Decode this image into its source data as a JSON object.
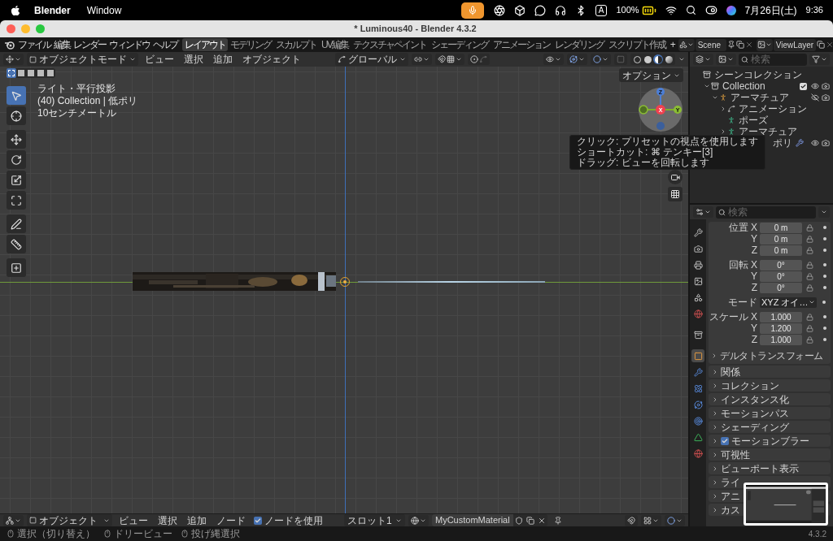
{
  "menubar": {
    "app": "Blender",
    "menus": [
      "Window"
    ],
    "input_indicator": "A",
    "battery": "100%",
    "date": "7月26日(土)",
    "time": "9:36"
  },
  "window": {
    "title": "* Luminous40 - Blender 4.3.2"
  },
  "topbar": {
    "menus": [
      "ファイル",
      "編集",
      "レンダー",
      "ウィンドウ",
      "ヘルプ"
    ],
    "workspaces": [
      {
        "label": "レイアウト",
        "selected": true
      },
      {
        "label": "モデリング",
        "selected": false
      },
      {
        "label": "スカルプト",
        "selected": false
      },
      {
        "label": "UV編集",
        "selected": false
      },
      {
        "label": "テクスチャペイント",
        "selected": false
      },
      {
        "label": "シェーディング",
        "selected": false
      },
      {
        "label": "アニメーション",
        "selected": false
      },
      {
        "label": "レンダリング",
        "selected": false
      },
      {
        "label": "スクリプト作成",
        "selected": false
      }
    ],
    "add_workspace": "+",
    "scene": "Scene",
    "view_layer": "ViewLayer"
  },
  "viewport": {
    "mode": "オブジェクトモード",
    "menus": [
      "ビュー",
      "選択",
      "追加",
      "オブジェクト"
    ],
    "orientation": "グローバル",
    "shading_modes": [
      {
        "selected": false
      },
      {
        "selected": false
      },
      {
        "selected": true
      },
      {
        "selected": false
      }
    ],
    "select_modes": [
      {
        "selected": true
      },
      {
        "selected": false
      },
      {
        "selected": false
      },
      {
        "selected": false
      },
      {
        "selected": false
      }
    ],
    "options": "オプション",
    "info": [
      "ライト・平行投影",
      "(40) Collection | 低ポリ",
      "10センチメートル"
    ],
    "tools": [
      {
        "selected": true
      },
      {
        "selected": false
      },
      {
        "selected": false
      },
      {
        "selected": false
      },
      {
        "selected": false
      },
      {
        "selected": false
      },
      {
        "selected": false
      },
      {
        "selected": false
      },
      {
        "selected": false
      }
    ],
    "gizmo": {
      "x": "X",
      "y": "Y",
      "z": "Z"
    },
    "tooltip": [
      "クリック: プリセットの視点を使用します",
      "ショートカット: ⌘ テンキー[3]",
      "ドラッグ: ビューを回転します"
    ]
  },
  "outliner": {
    "search_placeholder": "検索",
    "tree": [
      {
        "name": "シーンコレクション",
        "kind": "scene",
        "children": [
          {
            "name": "Collection",
            "kind": "collection",
            "expanded": true,
            "checked": true,
            "visible": true,
            "renderable": true,
            "children": [
              {
                "name": "アーマチュア",
                "kind": "armature",
                "expanded": true,
                "visible": false,
                "renderable": true,
                "children": [
                  {
                    "name": "アニメーション",
                    "kind": "action",
                    "expanded": false
                  },
                  {
                    "name": "ポーズ",
                    "kind": "pose"
                  },
                  {
                    "name": "アーマチュア",
                    "kind": "armature_data",
                    "expanded": false
                  }
                ]
              },
              {
                "name": "ポリ",
                "kind": "mesh",
                "visible": true,
                "renderable": true
              }
            ]
          }
        ]
      }
    ]
  },
  "properties": {
    "search_placeholder": "検索",
    "tabs": [
      {
        "selected": false
      },
      {
        "selected": false
      },
      {
        "selected": false
      },
      {
        "selected": false
      },
      {
        "selected": false
      },
      {
        "selected": false
      },
      {
        "selected": false
      },
      {
        "selected": true
      },
      {
        "selected": false
      },
      {
        "selected": false
      },
      {
        "selected": false
      },
      {
        "selected": false
      },
      {
        "selected": false
      },
      {
        "selected": false
      }
    ],
    "location": [
      {
        "label": "位置 X",
        "value": "0 m"
      },
      {
        "label": "Y",
        "value": "0 m"
      },
      {
        "label": "Z",
        "value": "0 m"
      }
    ],
    "rotation": [
      {
        "label": "回転 X",
        "value": "0°"
      },
      {
        "label": "Y",
        "value": "0°"
      },
      {
        "label": "Z",
        "value": "0°"
      }
    ],
    "mode": {
      "label": "モード",
      "value": "XYZ オイ…"
    },
    "scale": [
      {
        "label": "スケール X",
        "value": "1.000"
      },
      {
        "label": "Y",
        "value": "1.200"
      },
      {
        "label": "Z",
        "value": "1.000"
      }
    ],
    "delta": {
      "label": "デルタトランスフォーム",
      "expanded": false
    },
    "panels": [
      {
        "label": "関係",
        "kind": "panel",
        "expanded": false
      },
      {
        "label": "コレクション",
        "kind": "panel",
        "expanded": false
      },
      {
        "label": "インスタンス化",
        "kind": "panel",
        "expanded": false
      },
      {
        "label": "モーションパス",
        "kind": "panel",
        "expanded": false
      },
      {
        "label": "シェーディング",
        "kind": "panel",
        "expanded": false
      },
      {
        "label": "モーションブラー",
        "kind": "checkbox",
        "checked": true,
        "expanded": false
      },
      {
        "label": "可視性",
        "kind": "panel",
        "expanded": false
      },
      {
        "label": "ビューポート表示",
        "kind": "panel",
        "expanded": false
      },
      {
        "label": "ライ",
        "kind": "panel",
        "expanded": false
      },
      {
        "label": "アニ",
        "kind": "panel",
        "expanded": false
      },
      {
        "label": "カス",
        "kind": "panel",
        "expanded": false
      }
    ]
  },
  "node_header": {
    "mode": "オブジェクト",
    "menus": [
      "ビュー",
      "選択",
      "追加",
      "ノード"
    ],
    "use_nodes": {
      "label": "ノードを使用",
      "checked": true
    },
    "slot": "スロット1",
    "material": "MyCustomMaterial"
  },
  "status_bar": {
    "hints": [
      "選択（切り替え）",
      "ドリービュー",
      "投げ縄選択"
    ],
    "version": "4.3.2"
  }
}
